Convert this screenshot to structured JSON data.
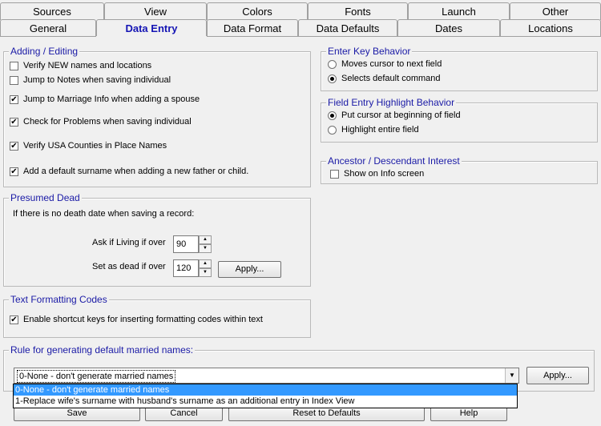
{
  "tabs_row1": [
    "Sources",
    "View",
    "Colors",
    "Fonts",
    "Launch",
    "Other"
  ],
  "tabs_row2": [
    "General",
    "Data Entry",
    "Data Format",
    "Data Defaults",
    "Dates",
    "Locations"
  ],
  "active_tab": "Data Entry",
  "adding_editing": {
    "title": "Adding / Editing",
    "items": [
      {
        "label": "Verify NEW names and locations",
        "checked": false
      },
      {
        "label": "Jump to Notes when saving individual",
        "checked": false
      },
      {
        "label": "Jump to Marriage Info when adding a spouse",
        "checked": true
      },
      {
        "label": "Check for Problems when saving individual",
        "checked": true
      },
      {
        "label": "Verify USA Counties in Place Names",
        "checked": true
      },
      {
        "label": "Add a default surname when adding a new father or child.",
        "checked": true
      }
    ]
  },
  "presumed_dead": {
    "title": "Presumed Dead",
    "intro": "If there is no death date when saving a record:",
    "ask_label": "Ask if Living if over",
    "ask_value": "90",
    "set_label": "Set as dead if over",
    "set_value": "120",
    "apply_label": "Apply..."
  },
  "text_formatting": {
    "title": "Text Formatting Codes",
    "item": {
      "label": "Enable shortcut keys for inserting formatting codes within text",
      "checked": true
    }
  },
  "enter_key": {
    "title": "Enter Key Behavior",
    "options": [
      {
        "label": "Moves cursor to next field",
        "selected": false
      },
      {
        "label": "Selects default command",
        "selected": true
      }
    ]
  },
  "field_entry": {
    "title": "Field Entry Highlight Behavior",
    "options": [
      {
        "label": "Put cursor at beginning of field",
        "selected": true
      },
      {
        "label": "Highlight entire field",
        "selected": false
      }
    ]
  },
  "ancestor": {
    "title": "Ancestor / Descendant Interest",
    "item": {
      "label": "Show on Info screen",
      "checked": false
    }
  },
  "married_names": {
    "title": "Rule for generating default married names:",
    "selected": "0-None - don't generate married names",
    "options": [
      "0-None - don't generate married names",
      "1-Replace wife's surname with husband's surname as an additional entry in Index View"
    ],
    "apply_label": "Apply..."
  },
  "footer": {
    "save": "Save",
    "cancel": "Cancel",
    "reset": "Reset to Defaults",
    "help": "Help"
  }
}
